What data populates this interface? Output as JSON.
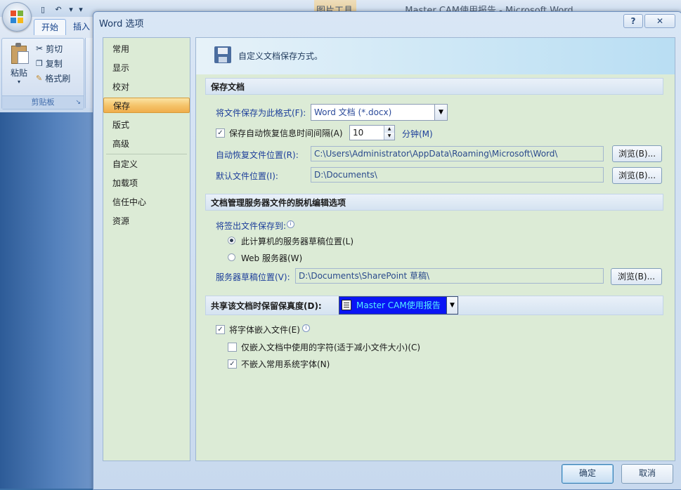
{
  "background_window": {
    "title": "Master CAM使用报告 - Microsoft Word",
    "context_tab": "图片工具",
    "ribbon_tabs": [
      "开始",
      "插入"
    ],
    "clipboard": {
      "paste": "粘贴",
      "cut": "剪切",
      "copy": "复制",
      "format_painter": "格式刷",
      "group_label": "剪贴板"
    }
  },
  "dialog": {
    "title": "Word 选项",
    "help": "?",
    "close": "✕",
    "nav": [
      "常用",
      "显示",
      "校对",
      "保存",
      "版式",
      "高级",
      "自定义",
      "加载项",
      "信任中心",
      "资源"
    ],
    "selected_nav": "保存",
    "header": "自定义文档保存方式。",
    "save_docs": {
      "section_title": "保存文档",
      "format_label": "将文件保存为此格式(F):",
      "format_value": "Word 文档 (*.docx)",
      "autorecover_label": "保存自动恢复信息时间间隔(A)",
      "autorecover_checked": true,
      "autorecover_minutes": "10",
      "minutes_label": "分钟(M)",
      "autorecover_location_label": "自动恢复文件位置(R):",
      "autorecover_location": "C:\\Users\\Administrator\\AppData\\Roaming\\Microsoft\\Word\\",
      "default_location_label": "默认文件位置(I):",
      "default_location": "D:\\Documents\\",
      "browse": "浏览(B)..."
    },
    "offline": {
      "section_title": "文档管理服务器文件的脱机编辑选项",
      "checkout_label": "将签出文件保存到:",
      "option_local": "此计算机的服务器草稿位置(L)",
      "option_web": "Web 服务器(W)",
      "selected": "local",
      "drafts_label": "服务器草稿位置(V):",
      "drafts_location": "D:\\Documents\\SharePoint 草稿\\",
      "browse": "浏览(B)..."
    },
    "fidelity": {
      "section_title": "共享该文档时保留保真度(D):",
      "document": "Master CAM使用报告",
      "embed_fonts": "将字体嵌入文件(E)",
      "embed_fonts_checked": true,
      "embed_used_only": "仅嵌入文档中使用的字符(适于减小文件大小)(C)",
      "embed_used_only_checked": false,
      "no_common_fonts": "不嵌入常用系统字体(N)",
      "no_common_fonts_checked": true
    },
    "ok": "确定",
    "cancel": "取消"
  }
}
